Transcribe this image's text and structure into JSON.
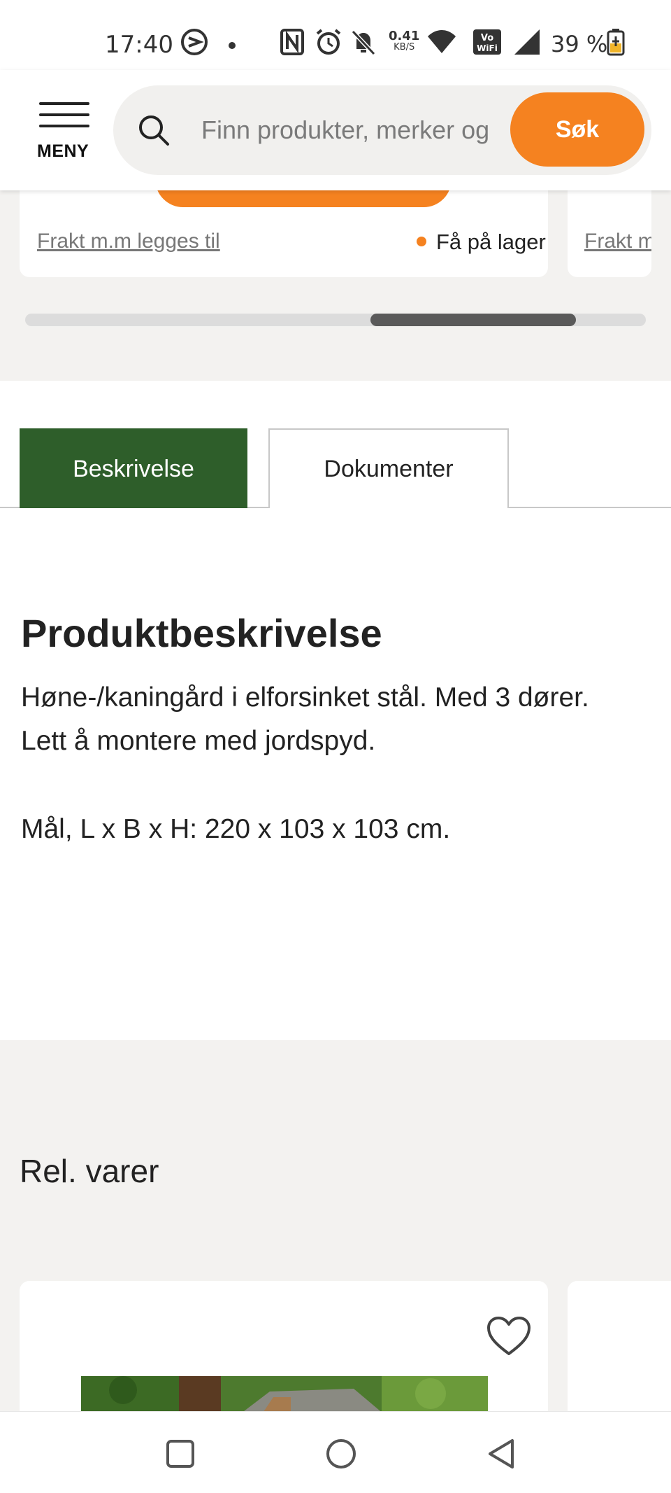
{
  "status_bar": {
    "time": "17:40",
    "battery": "39 %",
    "net_speed_value": "0.41",
    "net_speed_unit": "KB/S",
    "icons": [
      "s-icon",
      "dot-icon",
      "nfc-icon",
      "alarm-icon",
      "mute-icon",
      "net-speed-icon",
      "wifi-icon",
      "vowifi-icon",
      "signal-icon",
      "battery-icon"
    ]
  },
  "header": {
    "menu_label": "MENY",
    "search_placeholder": "Finn produkter, merker og",
    "search_button": "Søk"
  },
  "carousel": {
    "shipping_link": "Frakt m.m legges til",
    "shipping_link_partial": "Frakt m",
    "stock_status": "Få på lager",
    "stock_color": "#f58220",
    "scroll_position": 0.56
  },
  "tabs": [
    {
      "label": "Beskrivelse",
      "active": true
    },
    {
      "label": "Dokumenter",
      "active": false
    }
  ],
  "description": {
    "heading": "Produktbeskrivelse",
    "line1": "Høne-/kaningård i elforsinket stål. Med 3 dører.",
    "line2": "Lett å montere med jordspyd.",
    "line3": "Mål, L x B x H: 220 x 103 x 103 cm."
  },
  "related": {
    "heading": "Rel. varer"
  },
  "colors": {
    "accent_orange": "#f58220",
    "tab_active_green": "#2e5e2a",
    "section_bg": "#f3f2f0"
  }
}
